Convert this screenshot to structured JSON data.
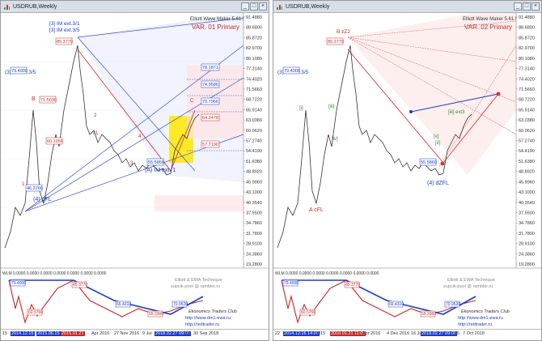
{
  "left": {
    "title": "USDRUB,Weekly",
    "maker": "Elliott Wave Maker 5.61.5",
    "variant": "VAR. 01 Primary",
    "watermark_lines": [
      "Elliott & EWA Technique",
      "zupcik-pool @ rambler.ru"
    ],
    "club_lines": [
      "Ekonomics Traders Club",
      "http://www.dm1-ewa.ru",
      "http://redtrader.ru"
    ],
    "indicator_label": "WLM 0.0000 0.0000 0.0000 0.0000 0.0000 0.0000 0.0000",
    "price_labels": [
      "91.4880",
      "88.6800",
      "85.8720",
      "82.9700",
      "80.1080",
      "77.3140",
      "74.4020",
      "71.5660",
      "68.7220",
      "65.9140",
      "63.0380",
      "60.0620",
      "57.2740",
      "54.4190",
      "51.6380",
      "48.8920",
      "45.9960",
      "43.1000",
      "40.3540",
      "37.5500",
      "34.7860",
      "31.7800",
      "28.9100",
      "24.3860",
      "19.2800"
    ],
    "wave_labels": {
      "ext35": "(3) IM ext.3/5",
      "ext31": "[3] IM ext.3/1",
      "ext312": "[3] IM ext.3/5",
      "eb": "B",
      "a_ext1": "(A) IM ext. 1",
      "four": "(4) pFL",
      "n1": "1",
      "n2": "2",
      "n3": "3",
      "n4": "4",
      "n5": "5",
      "x1": "x1",
      "c": "C"
    },
    "price_boxes": {
      "p1": "79.4000",
      "p2": "85.3770",
      "p3": "71.5030",
      "p4": "60.1050",
      "p5": "46.3760",
      "p6": "55.5860",
      "p7": "78.1871",
      "p8": "74.9586",
      "p9": "70.7966",
      "p10": "64.2478",
      "p11": "57.7190"
    },
    "ind_boxes": {
      "a": "79.4000",
      "b": "60.5760",
      "c": "85.3770",
      "d": "55.3360",
      "e": "66.4310",
      "f": "70.9520"
    },
    "dates": [
      "15",
      "2014.12.15",
      "2015.06.15",
      "2015.01.21",
      "Apr 2016",
      "27 Nov 2016",
      "9 Jul",
      "2018.02.27 09:00",
      "16",
      "30 Sep 2018"
    ]
  },
  "right": {
    "title": "USDRUB,Weekly",
    "maker": "Elliott Wave Maker 5.61.5",
    "variant": "VAR. 02 Primary",
    "watermark_lines": [
      "Elliott & EWA Technique",
      "zupcik-pool @ rambler.ru"
    ],
    "club_lines": [
      "Ekonomics Traders Club",
      "http://www.dm1-ewa.ru",
      "http://redtrader.ru"
    ],
    "indicator_label": "WLM 0.0000 0.0000 0.0000 0.0000 0.0000 0.0000 0.0000",
    "price_labels": [
      "91.4880",
      "88.6800",
      "85.8720",
      "82.9700",
      "80.1080",
      "77.3140",
      "74.4020",
      "71.5660",
      "68.7220",
      "65.9140",
      "63.0380",
      "60.0620",
      "57.2740",
      "54.4190",
      "51.6380",
      "48.8920",
      "45.9960",
      "43.1000",
      "40.3540",
      "37.5500",
      "34.7860",
      "31.7800",
      "28.9100",
      "24.3860",
      "19.2800"
    ],
    "wave_labels": {
      "ext35": "(3) IM ext.3/5",
      "bz": "B zZ2",
      "acfl": "A cFL",
      "dzfl": "(4) dZFL",
      "iv": "[iv]",
      "ii": "[ii]",
      "i": "[i]",
      "iii": "[iii]",
      "v": "[v]",
      "iiiL": "[iii] ext3",
      "c": "C"
    },
    "price_boxes": {
      "p1": "79.4000",
      "p2": "85.3770",
      "p3": "55.5860"
    },
    "ind_boxes": {
      "a": "79.4000",
      "b": "60.5760",
      "c": "85.3770",
      "d": "55.3360",
      "e": "66.4310",
      "f": "70.9520"
    },
    "dates": [
      "22",
      "2014.12.16 14:00",
      "2015",
      "2016.01.21 11:00",
      "Apr 2016",
      "4 Dec 2016",
      "16 Jul",
      "2018.02.27 09:00",
      "16",
      "7 Oct 2018"
    ]
  },
  "colors": {
    "up": "#2d8c2d",
    "down": "#c82828",
    "blue": "#1a3cc8",
    "yellow": "#ffe600",
    "box_fill": "#eef2ff"
  }
}
